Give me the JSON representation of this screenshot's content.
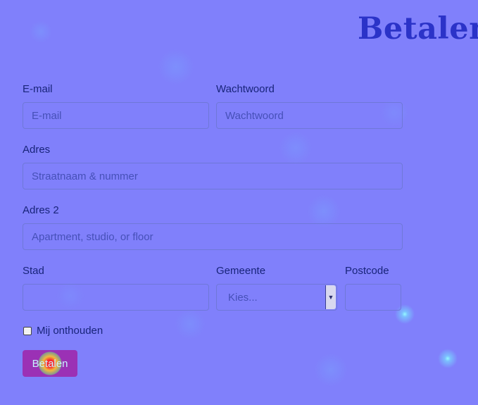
{
  "page": {
    "title": "Betalen"
  },
  "form": {
    "email": {
      "label": "E-mail",
      "placeholder": "E-mail"
    },
    "password": {
      "label": "Wachtwoord",
      "placeholder": "Wachtwoord"
    },
    "address": {
      "label": "Adres",
      "placeholder": "Straatnaam & nummer"
    },
    "address2": {
      "label": "Adres 2",
      "placeholder": "Apartment, studio, or floor"
    },
    "city": {
      "label": "Stad",
      "value": ""
    },
    "municipality": {
      "label": "Gemeente",
      "selected": "Kies..."
    },
    "postcode": {
      "label": "Postcode",
      "value": ""
    },
    "remember": {
      "label": "Mij onthouden"
    },
    "submit_label": "Betalen"
  },
  "colors": {
    "background": "#8080fb",
    "title": "#2b33c8",
    "button": "#9b31b5"
  },
  "icons": {
    "select_arrow": "chevron-down-icon",
    "checkbox": "checkbox-icon"
  }
}
